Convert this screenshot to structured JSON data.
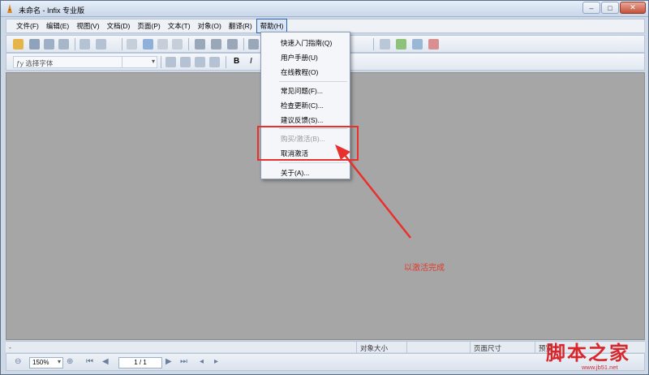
{
  "window": {
    "title": "未命名 - Infix 专业版",
    "minimize": "–",
    "maximize": "□",
    "close": "✕"
  },
  "menu": {
    "items": [
      "文件(F)",
      "编辑(E)",
      "视图(V)",
      "文档(D)",
      "页面(P)",
      "文本(T)",
      "对象(O)",
      "翻译(R)",
      "帮助(H)"
    ],
    "active": "帮助(H)"
  },
  "toolbar": {
    "font_placeholder": "选择字体",
    "bold": "B",
    "italic": "I"
  },
  "help_menu": {
    "items": [
      {
        "label": "快速入门指南(Q)",
        "enabled": true
      },
      {
        "label": "用户手册(U)",
        "enabled": true
      },
      {
        "label": "在线教程(O)",
        "enabled": true
      },
      {
        "label": "常见问题(F)...",
        "enabled": true
      },
      {
        "label": "检查更新(C)...",
        "enabled": true
      },
      {
        "label": "建议反馈(S)...",
        "enabled": true
      },
      {
        "label": "购买/激活(B)...",
        "enabled": false
      },
      {
        "label": "取消激活",
        "enabled": true
      },
      {
        "label": "关于(A)...",
        "enabled": true
      }
    ]
  },
  "annotation": {
    "text": "以激活完成",
    "color": "#e23a2d"
  },
  "status": {
    "left": "-",
    "object_size": "对象大小",
    "page_size": "页面尺寸",
    "preview": "预览"
  },
  "bottom": {
    "zoom": "150%",
    "page": "1 / 1"
  },
  "watermark": {
    "big": "脚本之家",
    "small": "www.jb51.net"
  }
}
